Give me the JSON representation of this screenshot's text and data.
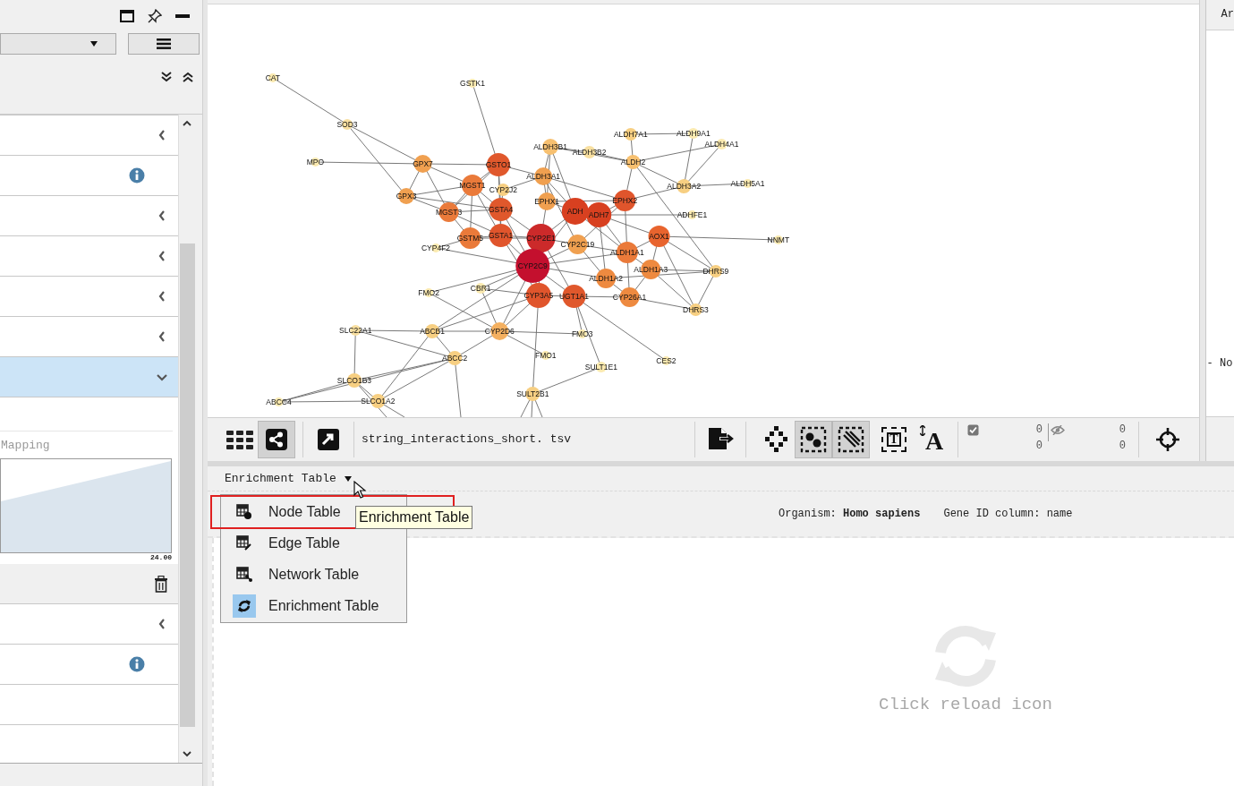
{
  "left_panel": {
    "rows": [
      {
        "kind": "collapsible",
        "expanded": false
      },
      {
        "kind": "info"
      },
      {
        "kind": "collapsible",
        "expanded": false
      },
      {
        "kind": "collapsible",
        "expanded": false
      },
      {
        "kind": "collapsible",
        "expanded": false
      },
      {
        "kind": "collapsible",
        "expanded": false
      },
      {
        "kind": "collapsible",
        "expanded": true,
        "mapping": {
          "label": "Mapping",
          "value": "24.00"
        }
      },
      {
        "kind": "collapsible",
        "expanded": false
      },
      {
        "kind": "info"
      },
      {
        "kind": "blank"
      },
      {
        "kind": "blank"
      }
    ]
  },
  "network_view": {
    "nodes": [
      {
        "label": "CAT",
        "color": "#fbeab0"
      },
      {
        "label": "GSTK1",
        "color": "#fbeab0"
      },
      {
        "label": "SOD3",
        "color": "#f8dfa0"
      },
      {
        "label": "ALDH7A1",
        "color": "#f7cf82"
      },
      {
        "label": "ALDH9A1",
        "color": "#fbeab0"
      },
      {
        "label": "ALDH3B1",
        "color": "#f7c070"
      },
      {
        "label": "ALDH4A1",
        "color": "#fbeab0"
      },
      {
        "label": "ALDH3B2",
        "color": "#f8dfa0"
      },
      {
        "label": "MPO",
        "color": "#fbeab0"
      },
      {
        "label": "GPX7",
        "color": "#f0a050"
      },
      {
        "label": "GSTO1",
        "color": "#e0582c"
      },
      {
        "label": "ALDH2",
        "color": "#f7c070"
      },
      {
        "label": "ALDH3A1",
        "color": "#f0a050"
      },
      {
        "label": "MGST1",
        "color": "#ea7a3a"
      },
      {
        "label": "ALDH3A2",
        "color": "#f7cf82"
      },
      {
        "label": "ALDH5A1",
        "color": "#fbeab0"
      },
      {
        "label": "CYP2J2",
        "color": "#f7cf82"
      },
      {
        "label": "GPX3",
        "color": "#f0a050"
      },
      {
        "label": "EPHX1",
        "color": "#f0a050"
      },
      {
        "label": "EPHX2",
        "color": "#e0552c"
      },
      {
        "label": "MGST3",
        "color": "#ea7a3a"
      },
      {
        "label": "GSTA4",
        "color": "#e0582c"
      },
      {
        "label": "ADH",
        "color": "#d84020"
      },
      {
        "label": "ADH7",
        "color": "#d84020"
      },
      {
        "label": "ADHFE1",
        "color": "#fbeab0"
      },
      {
        "label": "GSTM5",
        "color": "#ea7a3a"
      },
      {
        "label": "GSTA1",
        "color": "#e0552c"
      },
      {
        "label": "CYP2E1",
        "color": "#cc2a2a"
      },
      {
        "label": "AOX1",
        "color": "#e8642e"
      },
      {
        "label": "NNMT",
        "color": "#fbeab0"
      },
      {
        "label": "CYP4F2",
        "color": "#fbeab0"
      },
      {
        "label": "CYP2C19",
        "color": "#f0a050"
      },
      {
        "label": "ALDH1A1",
        "color": "#ea7a3a"
      },
      {
        "label": "CYP2C9",
        "color": "#c4102e"
      },
      {
        "label": "ALDH1A3",
        "color": "#ee8a40"
      },
      {
        "label": "DHRS9",
        "color": "#f7cf82"
      },
      {
        "label": "ALDH1A2",
        "color": "#ee8a40"
      },
      {
        "label": "FMO2",
        "color": "#fbeab0"
      },
      {
        "label": "CBR1",
        "color": "#fbeab0"
      },
      {
        "label": "CYP3A5",
        "color": "#e0552c"
      },
      {
        "label": "UGT1A1",
        "color": "#e0582c"
      },
      {
        "label": "CYP26A1",
        "color": "#ee8a40"
      },
      {
        "label": "DHRS3",
        "color": "#f7cf82"
      },
      {
        "label": "SLC22A1",
        "color": "#f8dfa0"
      },
      {
        "label": "ABCB1",
        "color": "#f7cf82"
      },
      {
        "label": "CYP2D6",
        "color": "#f4b060"
      },
      {
        "label": "FMO3",
        "color": "#fbeab0"
      },
      {
        "label": "ABCC2",
        "color": "#f7cf82"
      },
      {
        "label": "FMO1",
        "color": "#fbeab0"
      },
      {
        "label": "CES2",
        "color": "#fbeab0"
      },
      {
        "label": "SULT1E1",
        "color": "#fbeab0"
      },
      {
        "label": "SLCO1B3",
        "color": "#f7cf82"
      },
      {
        "label": "SULT2B1",
        "color": "#f7cf82"
      },
      {
        "label": "ABCC4",
        "color": "#fbeab0"
      },
      {
        "label": "SLCO1A2",
        "color": "#f7cf82"
      }
    ]
  },
  "right_panel": {
    "tab": "Ar",
    "item": "- No"
  },
  "toolbar": {
    "buttons": [
      {
        "kind": "grid",
        "selected": false
      },
      {
        "kind": "share",
        "selected": true
      },
      {
        "kind": "expand",
        "selected": false
      }
    ],
    "network_name": "string_interactions_short. tsv",
    "tools": [
      {
        "kind": "export",
        "selected": false
      },
      {
        "kind": "layout",
        "selected": false
      },
      {
        "kind": "node-select",
        "selected": true
      },
      {
        "kind": "edge-select",
        "selected": true
      },
      {
        "kind": "annotation",
        "selected": false,
        "glyph": "T"
      },
      {
        "kind": "font",
        "selected": false,
        "glyph": "A"
      }
    ],
    "counters": [
      {
        "kind": "selected",
        "values": [
          "0",
          "0"
        ]
      },
      {
        "kind": "hidden",
        "values": [
          "0",
          "0"
        ]
      }
    ],
    "end_tools": [
      {
        "kind": "fit",
        "selected": false
      }
    ]
  },
  "table_panel": {
    "selector": "Enrichment Table",
    "organism": "Organism: **Homo sapiens**",
    "gene_id": "Gene ID column: name",
    "reload_hint": "Click reload icon",
    "menu": [
      {
        "kind": "node",
        "label": "Node Table",
        "selected": false,
        "annotated": true
      },
      {
        "kind": "edge",
        "label": "Edge Table",
        "selected": false,
        "annotated": false
      },
      {
        "kind": "network",
        "label": "Network Table",
        "selected": false,
        "annotated": false
      },
      {
        "kind": "enrichment",
        "label": "Enrichment Table",
        "selected": true,
        "annotated": false
      }
    ],
    "tooltip": "Enrichment Table"
  }
}
